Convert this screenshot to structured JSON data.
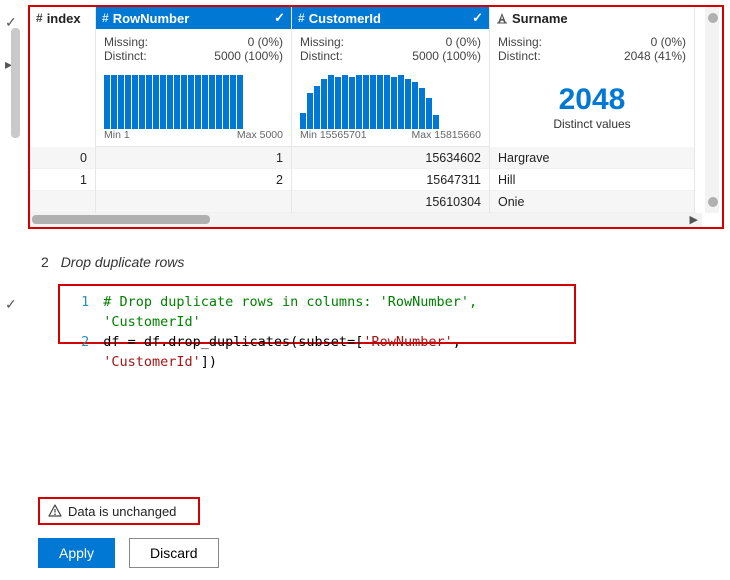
{
  "columns": {
    "index": {
      "label": "index",
      "type_icon": "#",
      "rows": [
        "0",
        "1",
        ""
      ]
    },
    "rownumber": {
      "label": "RowNumber",
      "type_icon": "#",
      "missing_label": "Missing:",
      "missing_value": "0 (0%)",
      "distinct_label": "Distinct:",
      "distinct_value": "5000 (100%)",
      "range_min": "Min 1",
      "range_max": "Max 5000",
      "rows": [
        "1",
        "2",
        ""
      ]
    },
    "customerid": {
      "label": "CustomerId",
      "type_icon": "#",
      "missing_label": "Missing:",
      "missing_value": "0 (0%)",
      "distinct_label": "Distinct:",
      "distinct_value": "5000 (100%)",
      "range_min": "Min 15565701",
      "range_max": "Max 15815660",
      "rows": [
        "15634602",
        "15647311",
        "15610304"
      ]
    },
    "surname": {
      "label": "Surname",
      "type_icon": "A",
      "missing_label": "Missing:",
      "missing_value": "0 (0%)",
      "distinct_label": "Distinct:",
      "distinct_value": "2048 (41%)",
      "bignum": "2048",
      "bignum_label": "Distinct values",
      "rows": [
        "Hargrave",
        "Hill",
        "Onie"
      ]
    }
  },
  "chart_data": [
    {
      "type": "bar",
      "title": "RowNumber",
      "xlabel": "",
      "ylabel": "",
      "xlim_label": [
        "Min 1",
        "Max 5000"
      ],
      "values": [
        250,
        250,
        250,
        250,
        250,
        250,
        250,
        250,
        250,
        250,
        250,
        250,
        250,
        250,
        250,
        250,
        250,
        250,
        250,
        250
      ]
    },
    {
      "type": "bar",
      "title": "CustomerId",
      "xlabel": "",
      "ylabel": "",
      "xlim_label": [
        "Min 15565701",
        "Max 15815660"
      ],
      "values": [
        90,
        200,
        240,
        280,
        300,
        290,
        300,
        290,
        300,
        300,
        300,
        300,
        300,
        290,
        300,
        280,
        260,
        230,
        170,
        80
      ]
    }
  ],
  "section": {
    "number": "2",
    "title": "Drop duplicate rows"
  },
  "code": {
    "lines": [
      {
        "n": "1",
        "type": "comment",
        "text": "# Drop duplicate rows in columns: 'RowNumber', 'CustomerId'"
      },
      {
        "n": "2",
        "type": "code",
        "prefix": "df = df.drop_duplicates(subset=[",
        "s1": "'RowNumber'",
        "sep": ", ",
        "s2": "'CustomerId'",
        "suffix": "])"
      }
    ]
  },
  "status": {
    "text": "Data is unchanged"
  },
  "buttons": {
    "apply": "Apply",
    "discard": "Discard"
  }
}
